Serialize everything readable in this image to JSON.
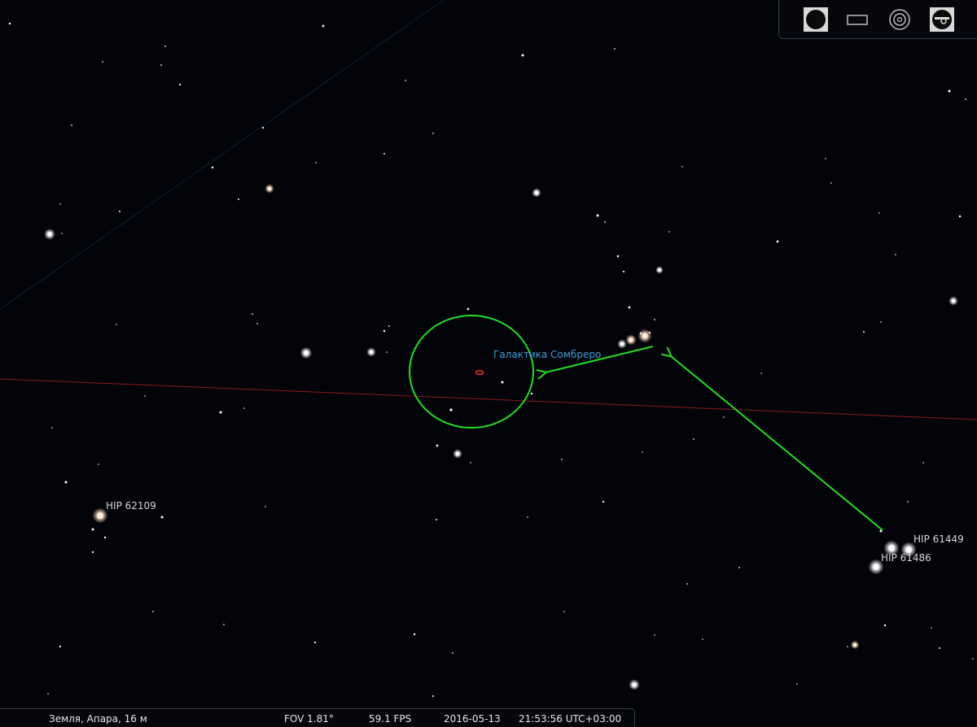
{
  "sky": {
    "labels": {
      "object_name": "Галактика Сомбреро",
      "hip_62109": "HIP 62109",
      "hip_61449": "HIP 61449",
      "hip_61486": "HIP 61486"
    },
    "colors": {
      "annotation_green": "#22dd22",
      "horizon_line": "#8b1a1a",
      "galaxy_marker": "#ff3030",
      "object_label": "#3fa0d6"
    }
  },
  "toolbar": {
    "buttons": [
      {
        "icon": "circle-fov-icon"
      },
      {
        "icon": "rectangle-fov-icon"
      },
      {
        "icon": "target-rings-icon"
      },
      {
        "icon": "telescope-sensor-icon"
      }
    ]
  },
  "status": {
    "location": "Земля, Апара, 16 м",
    "fov": "FOV 1.81°",
    "fps": "59.1 FPS",
    "date": "2016-05-13",
    "time": "21:53:56 UTC+03:00"
  }
}
